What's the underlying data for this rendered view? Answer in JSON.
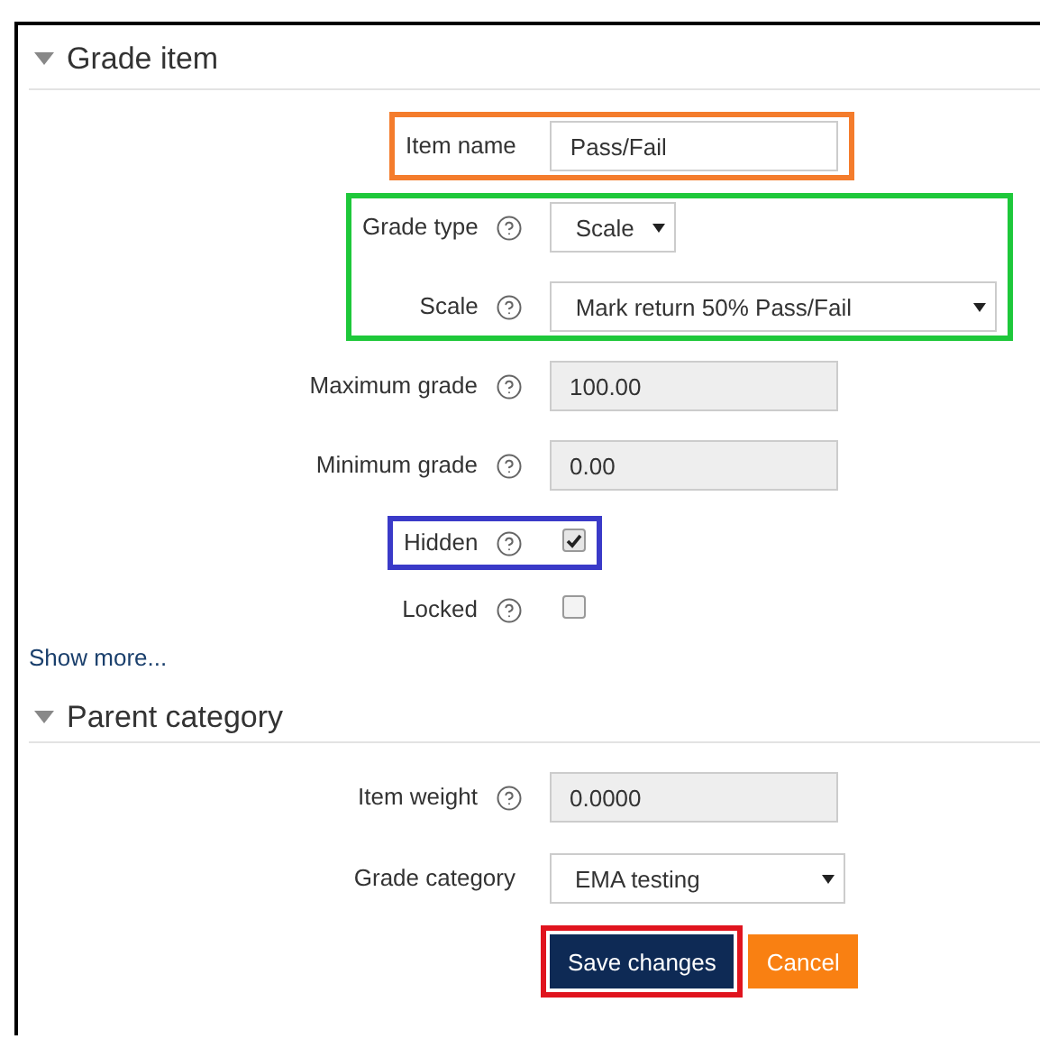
{
  "sections": [
    {
      "title": "Grade item",
      "expanded": true,
      "groups": [
        {
          "color": "#f47c2c",
          "fields": [
            {
              "label": "Item name",
              "help": false,
              "kind": "text",
              "value": "Pass/Fail"
            }
          ]
        },
        {
          "color": "#1ec83a",
          "fields": [
            {
              "label": "Grade type",
              "help": true,
              "kind": "short-select",
              "value": "Scale"
            },
            {
              "label": "Scale",
              "help": true,
              "kind": "long-select",
              "value": "Mark return 50% Pass/Fail"
            }
          ]
        },
        {
          "fields": [
            {
              "label": "Maximum grade",
              "help": true,
              "kind": "readonly",
              "value": "100.00"
            }
          ]
        },
        {
          "fields": [
            {
              "label": "Minimum grade",
              "help": true,
              "kind": "readonly",
              "value": "0.00"
            }
          ]
        },
        {
          "color": "#3a3ac8",
          "fields": [
            {
              "label": "Hidden",
              "help": true,
              "kind": "checkbox",
              "checked": true
            }
          ]
        },
        {
          "fields": [
            {
              "label": "Locked",
              "help": true,
              "kind": "checkbox",
              "checked": false
            }
          ]
        }
      ],
      "link": "Show more..."
    },
    {
      "title": "Parent category",
      "expanded": true,
      "groups": [
        {
          "fields": [
            {
              "label": "Item weight",
              "help": true,
              "kind": "readonly",
              "value": "0.0000"
            }
          ]
        },
        {
          "fields": [
            {
              "label": "Grade category",
              "help": false,
              "kind": "select",
              "value": "EMA testing"
            }
          ]
        }
      ]
    }
  ],
  "buttons": [
    {
      "label": "Save changes",
      "kind": "primary",
      "color": "#e0141e"
    },
    {
      "label": "Cancel",
      "kind": "cancel"
    }
  ]
}
